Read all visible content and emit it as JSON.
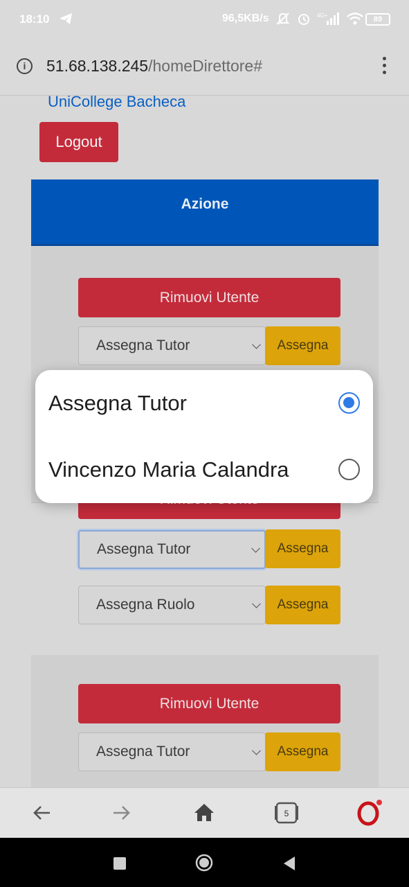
{
  "status_bar": {
    "time": "18:10",
    "speed": "96,5KB/s",
    "battery": "89",
    "icons": [
      "telegram-icon",
      "mute-icon",
      "alarm-icon",
      "signal-4g-icon",
      "wifi-icon",
      "battery-icon"
    ]
  },
  "browser": {
    "url_host": "51.68.138.245",
    "url_path": "/homeDirettore#"
  },
  "page": {
    "brand": "UniCollege Bacheca",
    "logout_label": "Logout",
    "table_header": "Azione",
    "remove_label": "Rimuovi Utente",
    "tutor_select_value": "Assegna Tutor",
    "role_select_value": "Assegna Ruolo",
    "assign_label": "Assegna",
    "hidden_remove_label": "Rimuovi Utente"
  },
  "popup": {
    "options": [
      {
        "label": "Assegna Tutor",
        "selected": true
      },
      {
        "label": "Vincenzo Maria Calandra",
        "selected": false
      }
    ]
  },
  "bottom_nav": {
    "tab_count": "5"
  },
  "colors": {
    "brand_link": "#0a5fc2",
    "danger": "#c42b3a",
    "warning": "#dca40a",
    "header_blue": "#0056b8",
    "radio_selected": "#2f7be6"
  }
}
